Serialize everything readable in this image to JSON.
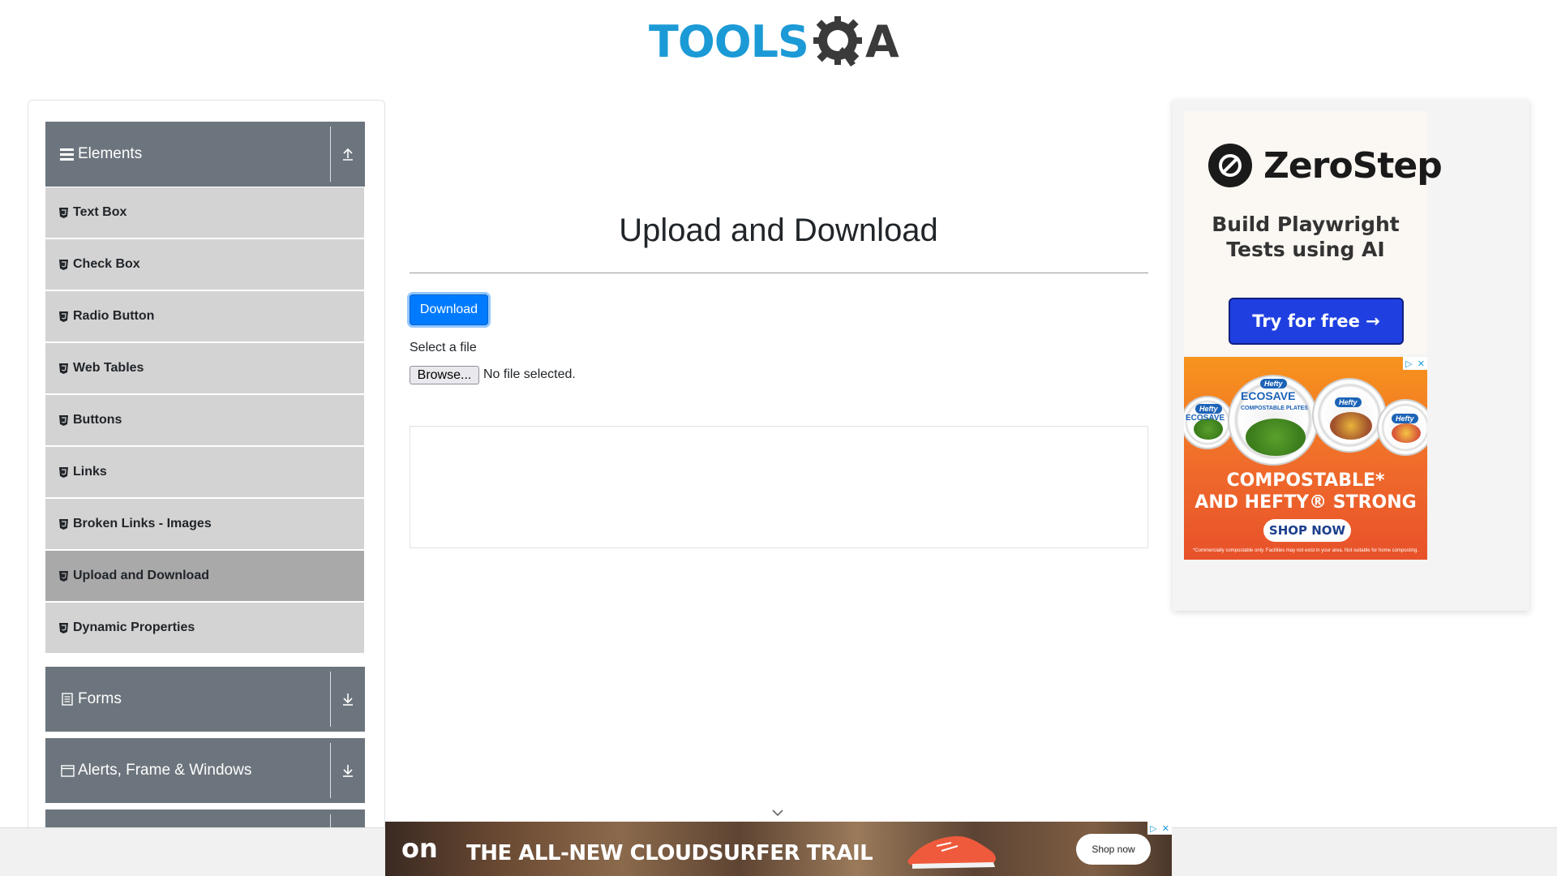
{
  "header": {
    "logo_tools": "TOOLS",
    "logo_a": "A"
  },
  "sidebar": {
    "elements_group": {
      "title": "Elements",
      "items": [
        {
          "label": "Text Box"
        },
        {
          "label": "Check Box"
        },
        {
          "label": "Radio Button"
        },
        {
          "label": "Web Tables"
        },
        {
          "label": "Buttons"
        },
        {
          "label": "Links"
        },
        {
          "label": "Broken Links - Images"
        },
        {
          "label": "Upload and Download"
        },
        {
          "label": "Dynamic Properties"
        }
      ],
      "active_item": "Upload and Download"
    },
    "forms_group": {
      "title": "Forms"
    },
    "alerts_group": {
      "title": "Alerts, Frame & Windows"
    }
  },
  "main": {
    "title": "Upload and Download",
    "download_button": "Download",
    "select_label": "Select a file",
    "browse_button": "Browse...",
    "no_file_text": "No file selected."
  },
  "right_ad": {
    "zerostep": {
      "brand": "ZeroStep",
      "tagline_line1": "Build Playwright",
      "tagline_line2": "Tests using AI",
      "cta": "Try for free →"
    },
    "hefty": {
      "badge1": "Hefty",
      "eco1": "ECOSAVE",
      "plate_label": "COMPOSTABLE PLATES",
      "badge2": "Hefty",
      "badge3": "Hefty",
      "badge4": "Hefty",
      "eco2": "ECOSAVE",
      "headline1": "COMPOSTABLE*",
      "headline2": "AND HEFTY® STRONG",
      "shop": "SHOP NOW",
      "fine_print": "*Commercially compostable only. Facilities may not exist in your area. Not suitable for home composting."
    }
  },
  "bottom_ad": {
    "brand": "on",
    "headline": "THE ALL-NEW CLOUDSURFER TRAIL",
    "shop": "Shop now"
  },
  "colors": {
    "group_header": "#6c757d",
    "menu_item": "#d3d3d3",
    "menu_item_active": "#a9a9a9",
    "primary": "#007bff",
    "logo_blue": "#1b9ad6"
  }
}
